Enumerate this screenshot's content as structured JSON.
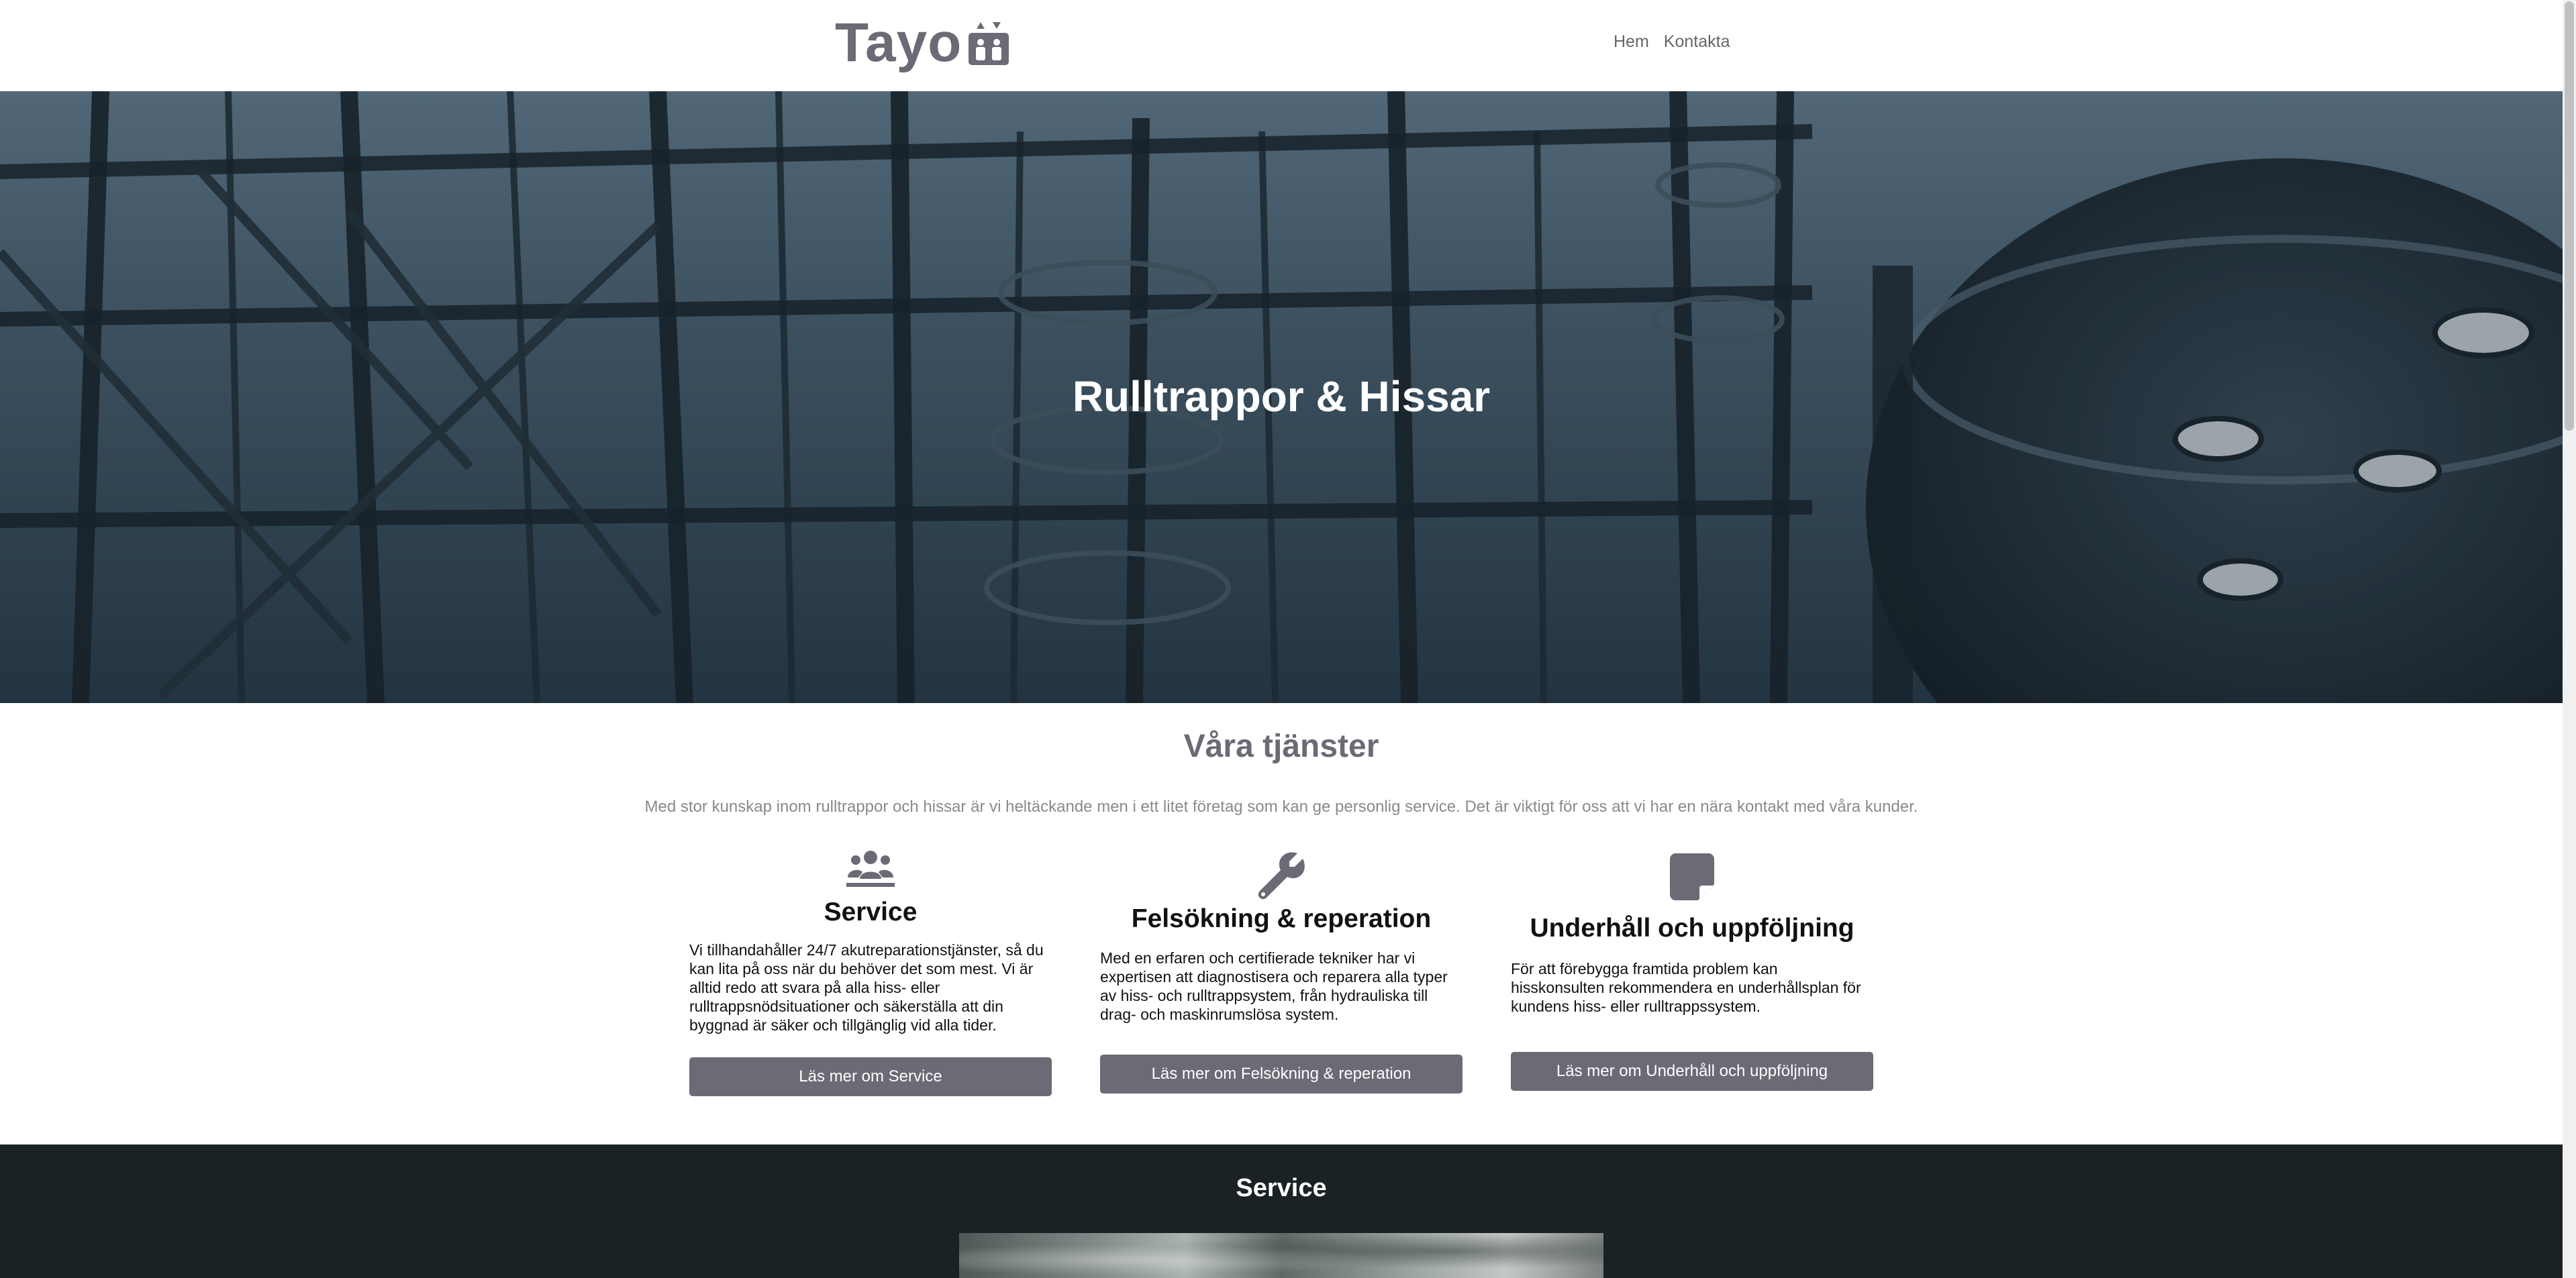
{
  "header": {
    "logo_text": "Tayo",
    "logo_icon": "elevator-icon",
    "nav": [
      "Hem",
      "Kontakta"
    ]
  },
  "hero": {
    "title": "Rulltrappor & Hissar"
  },
  "services": {
    "title": "Våra tjänster",
    "intro": "Med stor kunskap inom rulltrappor och hissar är vi heltäckande men i ett litet företag som kan ge personlig service. Det är viktigt för oss att vi har en nära kontakt med våra kunder.",
    "cards": [
      {
        "icon": "users-icon",
        "title": "Service",
        "text": "Vi tillhandahåller 24/7 akutreparationstjänster, så du kan lita på oss när du behöver det som mest. Vi är alltid redo att svara på alla hiss- eller rulltrappsnödsituationer och säkerställa att din byggnad är säker och tillgänglig vid alla tider.",
        "button": "Läs mer om Service"
      },
      {
        "icon": "wrench-icon",
        "title": "Felsökning & reperation",
        "text": "Med en erfaren och certifierade tekniker har vi expertisen att diagnostisera och reparera alla typer av hiss- och rulltrappsystem, från hydrauliska till drag- och maskinrumslösa system.",
        "button": "Läs mer om Felsökning & reperation"
      },
      {
        "icon": "note-icon",
        "title": "Underhåll och uppföljning",
        "text": "För att förebygga framtida problem kan hisskonsulten rekommendera en underhållsplan för kundens hiss- eller rulltrappssystem.",
        "button": "Läs mer om Underhåll och uppföljning"
      }
    ]
  },
  "service_section": {
    "title": "Service"
  },
  "colors": {
    "brand": "#6b6a75",
    "dark_bg": "#1b2224"
  }
}
